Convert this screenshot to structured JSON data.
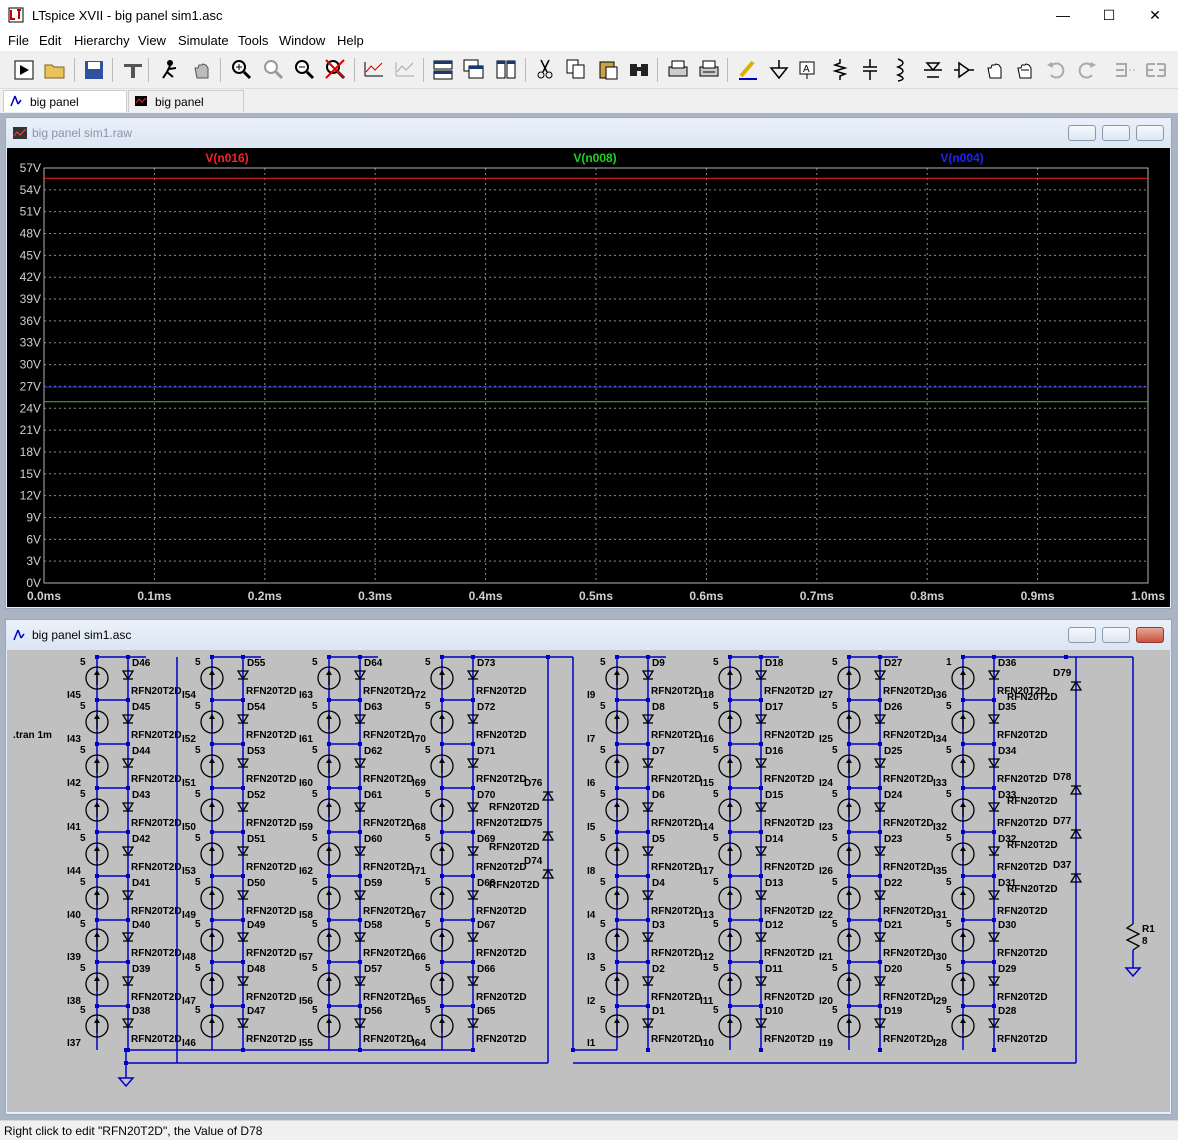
{
  "app": {
    "window_title": "LTspice XVII - big panel sim1.asc",
    "window_controls": {
      "minimize": "—",
      "maximize": "☐",
      "close": "✕"
    }
  },
  "menu": [
    "File",
    "Edit",
    "Hierarchy",
    "View",
    "Simulate",
    "Tools",
    "Window",
    "Help"
  ],
  "toolbar": {
    "icons": [
      "run-icon",
      "open-icon",
      "save-icon",
      "control-panel-icon",
      "probe-icon",
      "pan-hand-icon",
      "zoom-in-icon",
      "zoom-fit-icon",
      "zoom-out-icon",
      "zoom-cancel-icon",
      "autorange-icon",
      "autorange-disabled-icon",
      "tile-horizontal-icon",
      "cascade-icon",
      "tile-vertical-icon",
      "cut-icon",
      "copy-icon",
      "paste-icon",
      "find-icon",
      "print-icon",
      "print-setup-icon",
      "draw-wire-icon",
      "ground-icon",
      "label-net-icon",
      "resistor-icon",
      "capacitor-icon",
      "inductor-icon",
      "diode-icon",
      "component-icon",
      "move-icon",
      "drag-icon",
      "undo-icon",
      "redo-icon",
      "rotate-icon",
      "mirror-icon"
    ]
  },
  "tabs": [
    {
      "label": "big panel sim1.asc",
      "active": true
    },
    {
      "label": "big panel sim1.raw",
      "active": false
    }
  ],
  "waveform_window": {
    "title": "big panel sim1.raw",
    "colors": {
      "background": "#000000",
      "grid": "#8a8a8a",
      "axis_text": "#d0d0d0",
      "trace_n016": "#ff2020",
      "trace_n008": "#20d020",
      "trace_n004": "#2020ff"
    },
    "chart_data": {
      "type": "line",
      "title": "",
      "xlabel": "",
      "ylabel": "",
      "xlim": [
        0,
        1.0
      ],
      "ylim": [
        0,
        57
      ],
      "x_ticks": [
        "0.0ms",
        "0.1ms",
        "0.2ms",
        "0.3ms",
        "0.4ms",
        "0.5ms",
        "0.6ms",
        "0.7ms",
        "0.8ms",
        "0.9ms",
        "1.0ms"
      ],
      "y_ticks": [
        "0V",
        "3V",
        "6V",
        "9V",
        "12V",
        "15V",
        "18V",
        "21V",
        "24V",
        "27V",
        "30V",
        "33V",
        "36V",
        "39V",
        "42V",
        "45V",
        "48V",
        "51V",
        "54V",
        "57V"
      ],
      "grid": true,
      "series": [
        {
          "name": "V(n016)",
          "color": "#ff2020",
          "x": [
            0,
            1.0
          ],
          "values": [
            55.6,
            55.6
          ]
        },
        {
          "name": "V(n008)",
          "color": "#20d020",
          "x": [
            0,
            1.0
          ],
          "values": [
            24.9,
            24.9
          ]
        },
        {
          "name": "V(n004)",
          "color": "#2020ff",
          "x": [
            0,
            1.0
          ],
          "values": [
            26.9,
            26.9
          ]
        }
      ]
    }
  },
  "schematic_window": {
    "title": "big panel sim1.asc",
    "directive": ".tran 1m",
    "diode_model": "RFN20T2D",
    "resistor": {
      "name": "R1",
      "value": "8"
    },
    "panel_a": {
      "columns": [
        {
          "sources": [
            "I45",
            "I43",
            "I42",
            "I41",
            "I44",
            "I40",
            "I39",
            "I38",
            "I37"
          ],
          "diodes": [
            "D46",
            "D45",
            "D44",
            "D43",
            "D42",
            "D41",
            "D40",
            "D39",
            "D38"
          ]
        },
        {
          "sources": [
            "I54",
            "I52",
            "I51",
            "I50",
            "I53",
            "I49",
            "I48",
            "I47",
            "I46"
          ],
          "diodes": [
            "D55",
            "D54",
            "D53",
            "D52",
            "D51",
            "D50",
            "D49",
            "D48",
            "D47"
          ]
        },
        {
          "sources": [
            "I63",
            "I61",
            "I60",
            "I59",
            "I62",
            "I58",
            "I57",
            "I56",
            "I55"
          ],
          "diodes": [
            "D64",
            "D63",
            "D62",
            "D61",
            "D60",
            "D59",
            "D58",
            "D57",
            "D56"
          ]
        },
        {
          "sources": [
            "I72",
            "I70",
            "I69",
            "I68",
            "I71",
            "I67",
            "I66",
            "I65",
            "I64"
          ],
          "diodes": [
            "D73",
            "D72",
            "D71",
            "D70",
            "D69",
            "D68",
            "D67",
            "D66",
            "D65"
          ]
        }
      ],
      "bypass_diodes": [
        "D76",
        "D75",
        "D74"
      ]
    },
    "panel_b": {
      "columns": [
        {
          "sources": [
            "I9",
            "I7",
            "I6",
            "I5",
            "I8",
            "I4",
            "I3",
            "I2",
            "I1"
          ],
          "diodes": [
            "D9",
            "D8",
            "D7",
            "D6",
            "D5",
            "D4",
            "D3",
            "D2",
            "D1"
          ]
        },
        {
          "sources": [
            "I18",
            "I16",
            "I15",
            "I14",
            "I17",
            "I13",
            "I12",
            "I11",
            "I10"
          ],
          "diodes": [
            "D18",
            "D17",
            "D16",
            "D15",
            "D14",
            "D13",
            "D12",
            "D11",
            "D10"
          ]
        },
        {
          "sources": [
            "I27",
            "I25",
            "I24",
            "I23",
            "I26",
            "I22",
            "I21",
            "I20",
            "I19"
          ],
          "diodes": [
            "D27",
            "D26",
            "D25",
            "D24",
            "D23",
            "D22",
            "D21",
            "D20",
            "D19"
          ]
        },
        {
          "sources": [
            "I36",
            "I34",
            "I33",
            "I32",
            "I35",
            "I31",
            "I30",
            "I29",
            "I28"
          ],
          "diodes": [
            "D36",
            "D35",
            "D34",
            "D33",
            "D32",
            "D31",
            "D30",
            "D29",
            "D28"
          ]
        }
      ],
      "bypass_diodes": [
        "D79",
        "D78",
        "D77",
        "D37"
      ]
    },
    "source_value": "5",
    "first_source_value_col8": "1"
  },
  "status": {
    "text": "Right click to edit \"RFN20T2D\", the Value of D78"
  }
}
